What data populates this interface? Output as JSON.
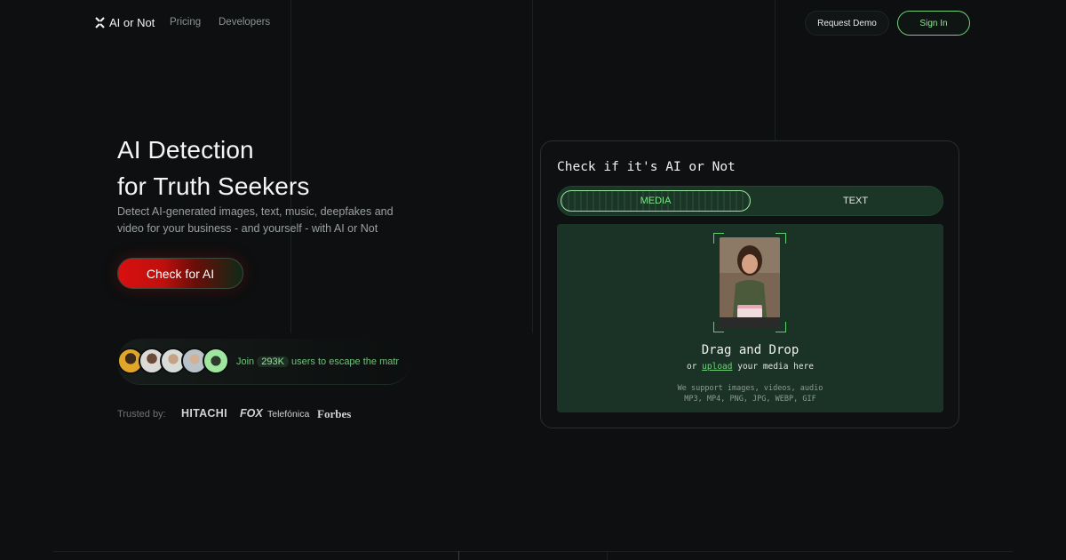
{
  "nav": {
    "logo": "AI or Not",
    "links": [
      "Pricing",
      "Developers"
    ],
    "request_demo": "Request Demo",
    "sign_in": "Sign In"
  },
  "hero": {
    "title_line1": "AI Detection",
    "title_line2": "for Truth Seekers",
    "subtitle": "Detect AI-generated images, text, music, deepfakes and video for your business - and yourself - with AI or Not",
    "cta": "Check for AI",
    "join_prefix": "Join",
    "join_count": "293K",
    "join_suffix": "users to escape the matr"
  },
  "trusted": {
    "label": "Trusted by:",
    "brands": [
      "HITACHI",
      "FOX",
      "Telefónica",
      "Forbes"
    ]
  },
  "detector": {
    "title": "Check if it's AI or Not",
    "tabs": [
      "MEDIA",
      "TEXT"
    ],
    "active_tab": "MEDIA",
    "drop_title": "Drag and Drop",
    "drop_sub_prefix": "or",
    "drop_sub_link": "upload",
    "drop_sub_suffix": "your media here",
    "support_line1": "We support images, videos, audio",
    "support_line2": "MP3, MP4, PNG, JPG, WEBP, GIF"
  },
  "colors": {
    "background": "#0d0f10",
    "accent_green": "#6fd47a",
    "cta_red": "#d90f0f",
    "panel_green": "#1b3326"
  }
}
